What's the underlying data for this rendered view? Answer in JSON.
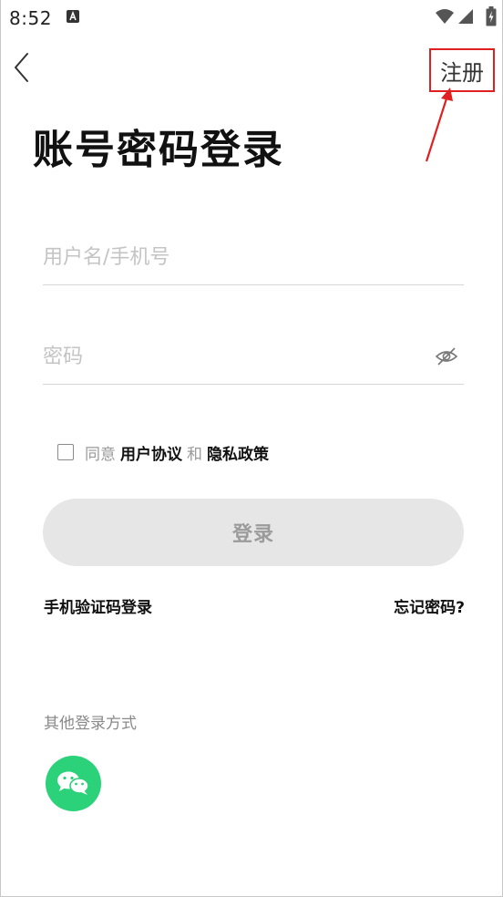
{
  "status_bar": {
    "time": "8:52",
    "app_icon": "text-a-icon",
    "wifi_icon": "wifi-icon",
    "signal_icon": "signal-icon",
    "battery_icon": "battery-charging-icon"
  },
  "header": {
    "back_icon": "chevron-left-icon",
    "register_label": "注册",
    "annotation_color": "#e02020"
  },
  "title": "账号密码登录",
  "username": {
    "placeholder": "用户名/手机号",
    "value": ""
  },
  "password": {
    "placeholder": "密码",
    "value": "",
    "toggle_icon": "eye-off-icon"
  },
  "agreement": {
    "checked": false,
    "prefix": "同意",
    "user_agreement": "用户协议",
    "conjunction": "和",
    "privacy_policy": "隐私政策"
  },
  "login_button_label": "登录",
  "sms_login_label": "手机验证码登录",
  "forgot_password_label": "忘记密码?",
  "other_login": {
    "label": "其他登录方式",
    "wechat_icon": "wechat-icon",
    "wechat_color": "#2bd27a"
  }
}
